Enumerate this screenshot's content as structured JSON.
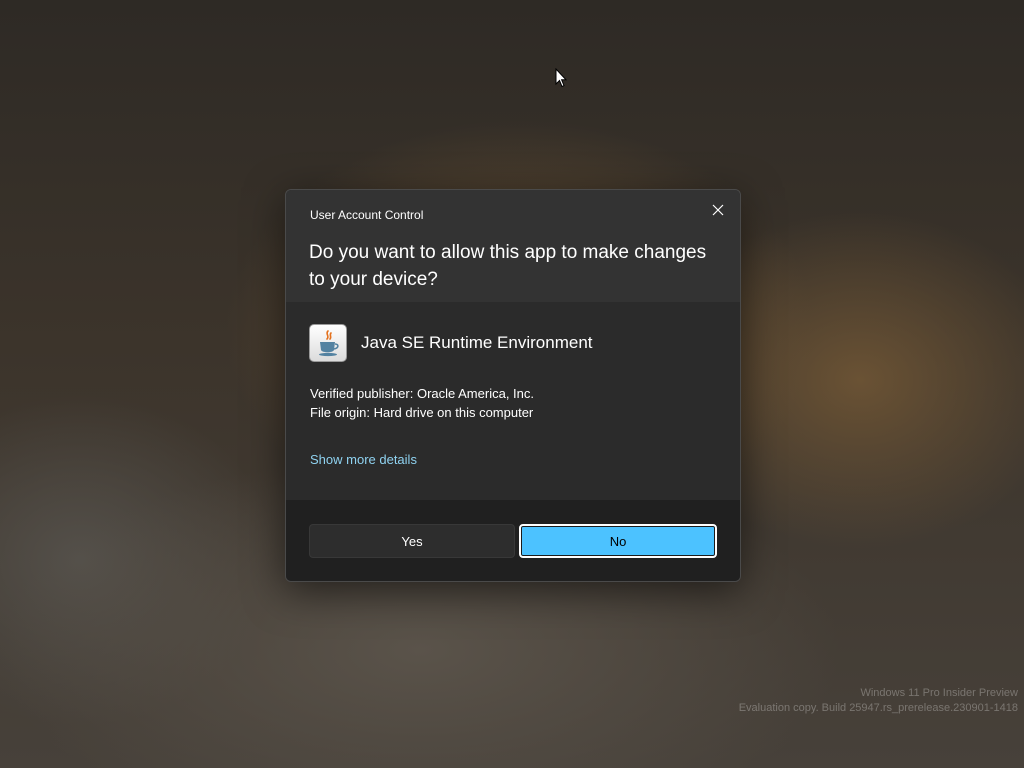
{
  "dialog": {
    "title": "User Account Control",
    "question": "Do you want to allow this app to make changes to your device?",
    "close_icon": "close-icon",
    "app": {
      "icon": "java-icon",
      "name": "Java SE Runtime Environment"
    },
    "publisher": "Verified publisher: Oracle America, Inc.",
    "origin": "File origin: Hard drive on this computer",
    "details_link": "Show more details",
    "buttons": {
      "yes": "Yes",
      "no": "No"
    }
  },
  "watermark": {
    "line1": "Windows 11 Pro Insider Preview",
    "line2": "Evaluation copy. Build 25947.rs_prerelease.230901-1418"
  },
  "colors": {
    "accent": "#4cc2ff",
    "link": "#8fd2f0",
    "dialog_bg": "#2b2b2b",
    "footer_bg": "#202020"
  }
}
